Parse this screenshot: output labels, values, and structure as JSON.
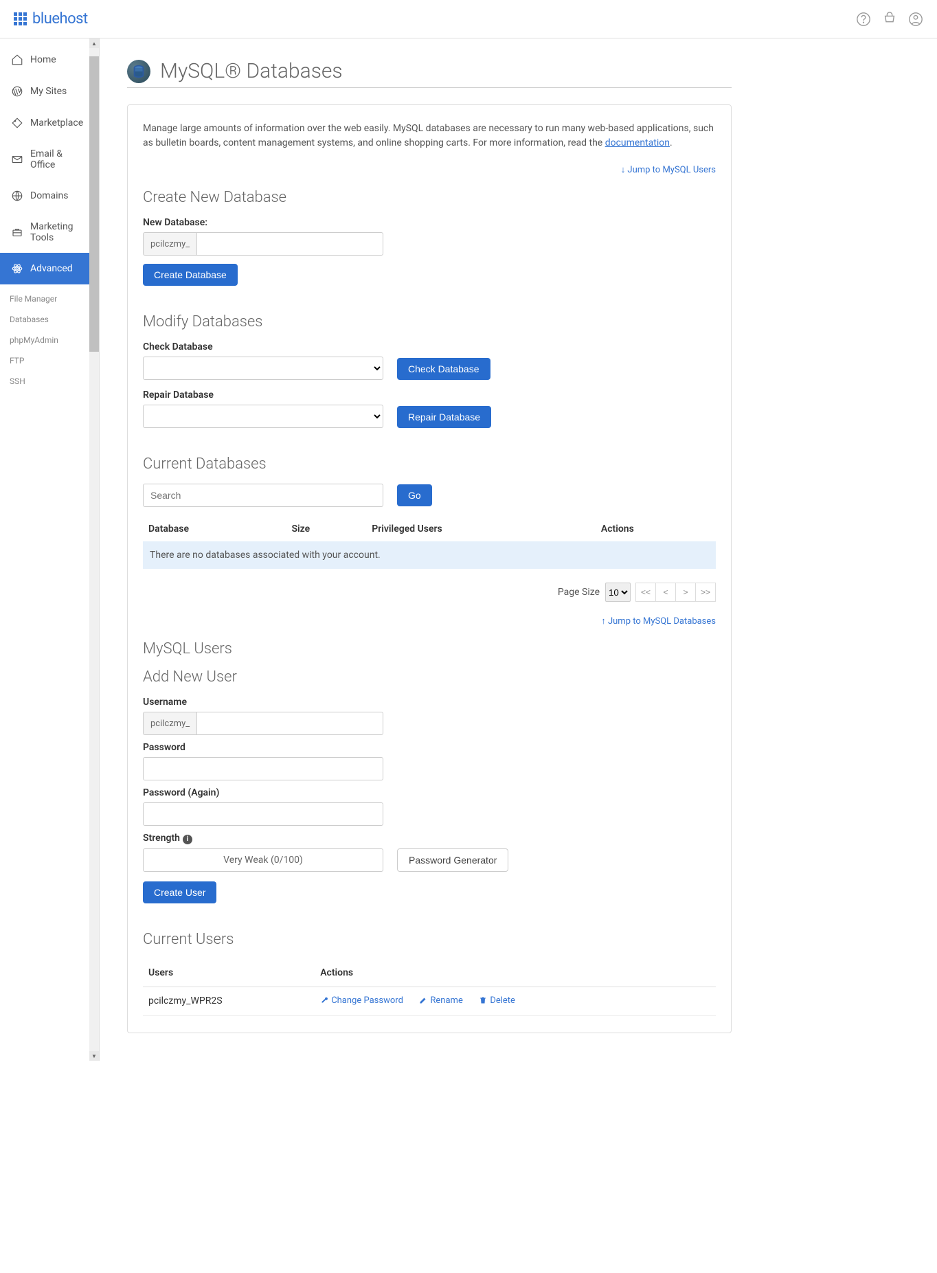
{
  "header": {
    "brand": "bluehost"
  },
  "sidebar": {
    "items": [
      {
        "label": "Home"
      },
      {
        "label": "My Sites"
      },
      {
        "label": "Marketplace"
      },
      {
        "label": "Email & Office"
      },
      {
        "label": "Domains"
      },
      {
        "label": "Marketing Tools"
      },
      {
        "label": "Advanced"
      }
    ],
    "sub": [
      {
        "label": "File Manager"
      },
      {
        "label": "Databases"
      },
      {
        "label": "phpMyAdmin"
      },
      {
        "label": "FTP"
      },
      {
        "label": "SSH"
      }
    ]
  },
  "page": {
    "title": "MySQL® Databases",
    "intro_pre": "Manage large amounts of information over the web easily. MySQL databases are necessary to run many web-based applications, such as bulletin boards, content management systems, and online shopping carts. For more information, read the ",
    "intro_link": "documentation",
    "intro_post": ".",
    "jump_users": "Jump to MySQL Users",
    "jump_databases": "Jump to MySQL Databases"
  },
  "create_db": {
    "section": "Create New Database",
    "label": "New Database:",
    "prefix": "pcilczmy_",
    "button": "Create Database"
  },
  "modify_db": {
    "section": "Modify Databases",
    "check_label": "Check Database",
    "check_button": "Check Database",
    "repair_label": "Repair Database",
    "repair_button": "Repair Database"
  },
  "current_db": {
    "section": "Current Databases",
    "search_placeholder": "Search",
    "go_button": "Go",
    "columns": {
      "database": "Database",
      "size": "Size",
      "privileged": "Privileged Users",
      "actions": "Actions"
    },
    "empty": "There are no databases associated with your account.",
    "page_size_label": "Page Size",
    "page_size_value": "10",
    "pager": {
      "first": "<<",
      "prev": "<",
      "next": ">",
      "last": ">>"
    }
  },
  "users": {
    "section": "MySQL Users",
    "add_section": "Add New User",
    "username_label": "Username",
    "username_prefix": "pcilczmy_",
    "password_label": "Password",
    "password_again_label": "Password (Again)",
    "strength_label": "Strength",
    "strength_value": "Very Weak (0/100)",
    "generator_button": "Password Generator",
    "create_button": "Create User"
  },
  "current_users": {
    "section": "Current Users",
    "columns": {
      "users": "Users",
      "actions": "Actions"
    },
    "rows": [
      {
        "user": "pcilczmy_WPR2S"
      }
    ],
    "actions": {
      "change_password": "Change Password",
      "rename": "Rename",
      "delete": "Delete"
    }
  }
}
